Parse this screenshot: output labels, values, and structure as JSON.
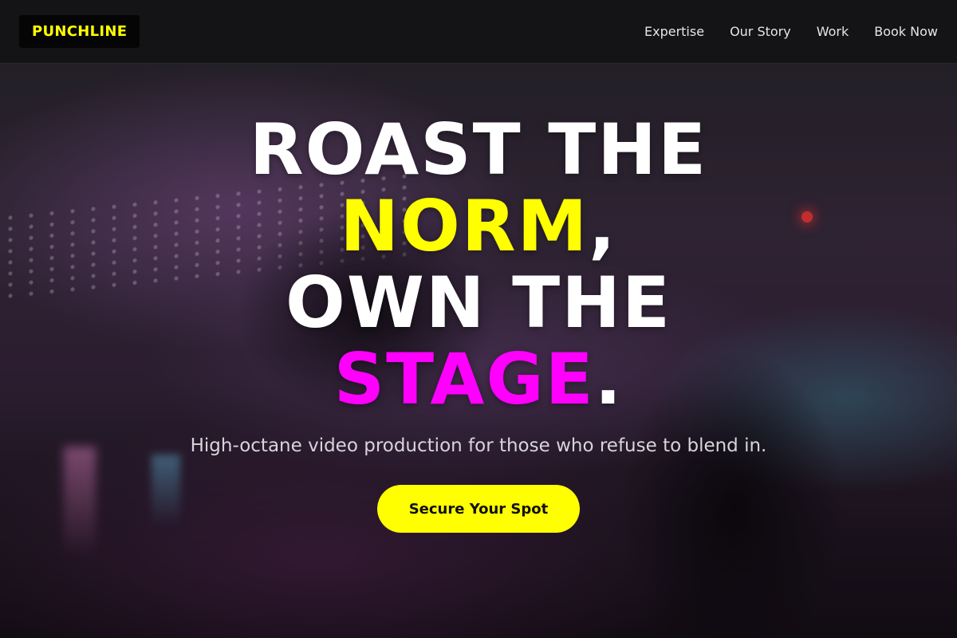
{
  "brand": {
    "logo_text": "PUNCHLINE"
  },
  "nav": {
    "links": [
      {
        "label": "Expertise"
      },
      {
        "label": "Our Story"
      },
      {
        "label": "Work"
      },
      {
        "label": "Book Now"
      }
    ]
  },
  "hero": {
    "headline": {
      "line1": "ROAST THE",
      "line2_highlight": "NORM",
      "line2_rest": ",",
      "line3": "OWN THE",
      "line4_highlight": "STAGE",
      "line4_rest": "."
    },
    "subheadline": "High-octane video production for those who refuse to blend in.",
    "cta_label": "Secure Your Spot"
  },
  "colors": {
    "accent_yellow": "#ffff00",
    "accent_magenta": "#ff00ff",
    "nav_background": "#141315",
    "text_white": "#ffffff"
  }
}
